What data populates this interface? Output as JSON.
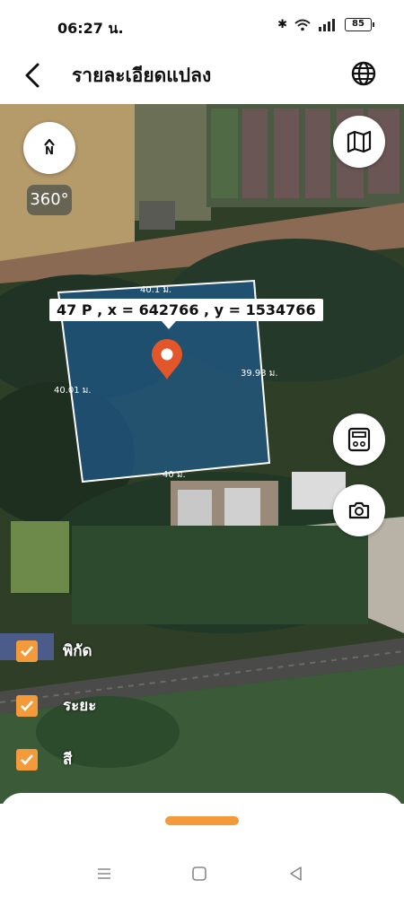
{
  "status_bar": {
    "time": "06:27 น.",
    "battery": "85"
  },
  "header": {
    "title": "รายละเอียดแปลง",
    "back_icon": "back-arrow-icon",
    "globe_icon": "globe-icon"
  },
  "map": {
    "compass_label": "N",
    "rotation_label": "360°",
    "plot_info": "47 P , x = 642766 , y = 1534766",
    "edges": {
      "top": "40.1 ม.",
      "right": "39.93 ม.",
      "bottom": "40 ม.",
      "left": "40.01 ม."
    },
    "plot_color": "#1f5a8c",
    "pin_color": "#e2562a"
  },
  "layers": [
    {
      "label": "พิกัด",
      "checked": true
    },
    {
      "label": "ระยะ",
      "checked": true
    },
    {
      "label": "สี",
      "checked": true
    }
  ],
  "accent_color": "#f39a3a"
}
